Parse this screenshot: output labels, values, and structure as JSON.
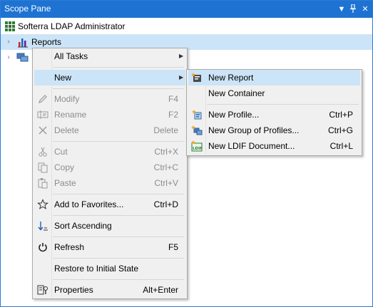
{
  "pane": {
    "title": "Scope Pane",
    "dropdown_glyph": "▼",
    "pin_glyph": "⊥",
    "close_glyph": "✕"
  },
  "tree": {
    "root_label": "Softerra LDAP Administrator",
    "reports_label": "Reports",
    "expand_glyph": "›"
  },
  "context_menu": {
    "all_tasks": "All Tasks",
    "new": "New",
    "modify": "Modify",
    "modify_sc": "F4",
    "rename": "Rename",
    "rename_sc": "F2",
    "delete": "Delete",
    "delete_sc": "Delete",
    "cut": "Cut",
    "cut_sc": "Ctrl+X",
    "copy": "Copy",
    "copy_sc": "Ctrl+C",
    "paste": "Paste",
    "paste_sc": "Ctrl+V",
    "add_fav": "Add to Favorites...",
    "add_fav_sc": "Ctrl+D",
    "sort": "Sort Ascending",
    "refresh": "Refresh",
    "refresh_sc": "F5",
    "restore": "Restore to Initial State",
    "properties": "Properties",
    "properties_sc": "Alt+Enter",
    "submenu_glyph": "▶"
  },
  "new_submenu": {
    "new_report": "New Report",
    "new_container": "New Container",
    "new_profile": "New Profile...",
    "new_profile_sc": "Ctrl+P",
    "new_group": "New Group of Profiles...",
    "new_group_sc": "Ctrl+G",
    "new_ldif": "New LDIF Document...",
    "new_ldif_sc": "Ctrl+L"
  },
  "colors": {
    "titlebar": "#1e73d2",
    "highlight": "#cce4f7",
    "menu_bg": "#f0f0f0"
  }
}
